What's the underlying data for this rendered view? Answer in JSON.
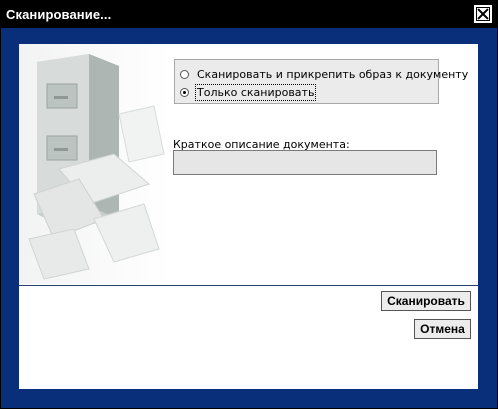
{
  "window": {
    "title": "Сканирование...",
    "close_icon": "close-icon"
  },
  "options": {
    "items": [
      {
        "label": "Сканировать и прикрепить образ к документу",
        "selected": false
      },
      {
        "label": "Только сканировать",
        "selected": true
      }
    ]
  },
  "description": {
    "label": "Краткое описание документа:",
    "value": ""
  },
  "buttons": {
    "scan_label": "Сканировать",
    "cancel_label": "Отмена"
  },
  "colors": {
    "window_frame": "#0a2f7a",
    "title_bar": "#000000",
    "field_bg": "#e6e6e6"
  },
  "illustration": "file-cabinet-with-papers"
}
